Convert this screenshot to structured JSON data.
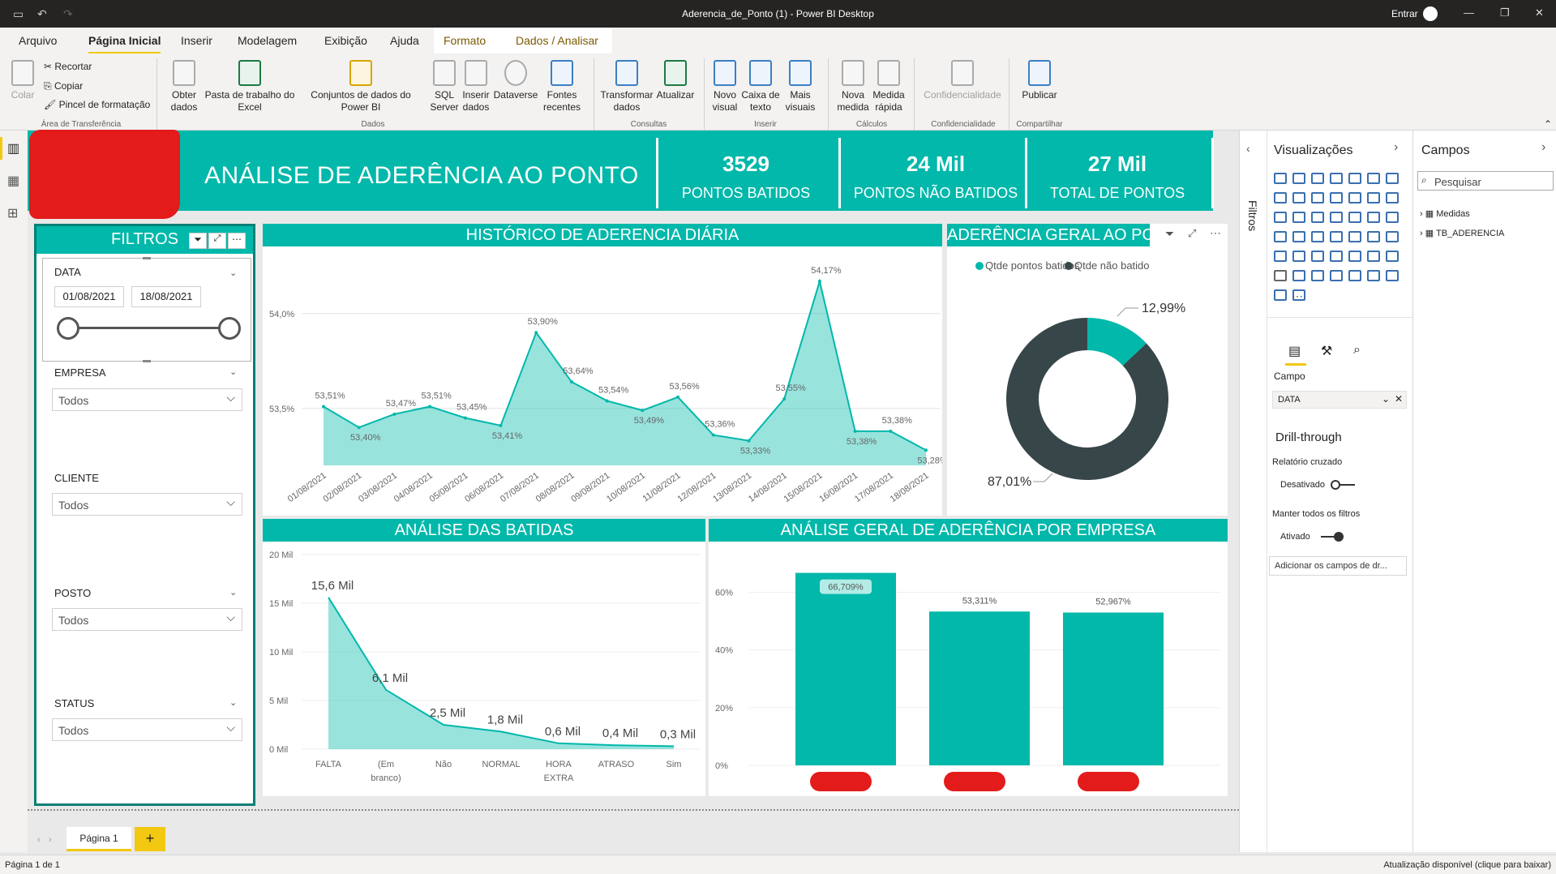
{
  "titlebar": {
    "title": "Aderencia_de_Ponto (1) - Power BI Desktop",
    "signin": "Entrar"
  },
  "menu": {
    "tabs": [
      "Arquivo",
      "Página Inicial",
      "Inserir",
      "Modelagem",
      "Exibição",
      "Ajuda",
      "Formato",
      "Dados / Analisar"
    ],
    "active": "Página Inicial"
  },
  "ribbon": {
    "paste": "Colar",
    "cut": "Recortar",
    "copy": "Copiar",
    "format_painter": "Pincel de formatação",
    "get_data": "Obter dados",
    "excel": "Pasta de trabalho do Excel",
    "datasets": "Conjuntos de dados do Power BI",
    "sql": "SQL Server",
    "enter_data": "Inserir dados",
    "dataverse": "Dataverse",
    "recent": "Fontes recentes",
    "transform": "Transformar dados",
    "refresh": "Atualizar",
    "new_visual": "Novo visual",
    "textbox": "Caixa de texto",
    "more_visuals": "Mais visuais",
    "new_measure": "Nova medida",
    "quick_measure": "Medida rápida",
    "sensitivity": "Confidencialidade",
    "publish": "Publicar",
    "groups": {
      "clipboard": "Área de Transferência",
      "data": "Dados",
      "queries": "Consultas",
      "insert": "Inserir",
      "calc": "Cálculos",
      "sensitivity": "Confidencialidade",
      "share": "Compartilhar"
    }
  },
  "report": {
    "title": "ANÁLISE DE ADERÊNCIA AO PONTO",
    "kpis": [
      {
        "value": "3529",
        "label": "PONTOS BATIDOS"
      },
      {
        "value": "24 Mil",
        "label": "PONTOS NÃO BATIDOS"
      },
      {
        "value": "27 Mil",
        "label": "TOTAL DE PONTOS"
      }
    ],
    "filters": {
      "title": "FILTROS",
      "date_label": "DATA",
      "date_from": "01/08/2021",
      "date_to": "18/08/2021",
      "slicers": [
        {
          "label": "EMPRESA",
          "value": "Todos"
        },
        {
          "label": "CLIENTE",
          "value": "Todos"
        },
        {
          "label": "POSTO",
          "value": "Todos"
        },
        {
          "label": "STATUS",
          "value": "Todos"
        }
      ]
    },
    "hist_title": "HISTÓRICO DE ADERENCIA DIÁRIA",
    "donut_title": "ADERÊNCIA GERAL AO PO",
    "batidas_title": "ANÁLISE DAS BATIDAS",
    "empresa_title": "ANÁLISE GERAL DE ADERÊNCIA POR EMPRESA"
  },
  "chart_data": [
    {
      "type": "area",
      "title": "HISTÓRICO DE ADERENCIA DIÁRIA",
      "x": [
        "01/08/2021",
        "02/08/2021",
        "03/08/2021",
        "04/08/2021",
        "05/08/2021",
        "06/08/2021",
        "07/08/2021",
        "08/08/2021",
        "09/08/2021",
        "10/08/2021",
        "11/08/2021",
        "12/08/2021",
        "13/08/2021",
        "14/08/2021",
        "15/08/2021",
        "16/08/2021",
        "17/08/2021",
        "18/08/2021"
      ],
      "values": [
        53.51,
        53.4,
        53.47,
        53.51,
        53.45,
        53.41,
        53.9,
        53.64,
        53.54,
        53.49,
        53.56,
        53.36,
        53.33,
        53.55,
        54.17,
        53.38,
        53.38,
        53.28
      ],
      "labels": [
        "53,51%",
        "53,40%",
        "53,47%",
        "53,51%",
        "53,45%",
        "53,41%",
        "53,90%",
        "53,64%",
        "53,54%",
        "53,49%",
        "53,56%",
        "53,36%",
        "53,33%",
        "53,55%",
        "54,17%",
        "53,38%",
        "53,38%",
        "53,28%"
      ],
      "y_ticks": [
        "54,0%",
        "53,5%"
      ],
      "y_tick_values": [
        54.0,
        53.5
      ],
      "ylim": [
        53.2,
        54.2
      ],
      "color": "#01b8aa"
    },
    {
      "type": "pie",
      "title": "ADERÊNCIA GERAL AO PO",
      "legend": [
        "Qtde pontos batidos",
        "Qtde não batido"
      ],
      "values": [
        12.99,
        87.01
      ],
      "labels": [
        "12,99%",
        "87,01%"
      ],
      "colors": [
        "#01b8aa",
        "#374649"
      ]
    },
    {
      "type": "area",
      "title": "ANÁLISE DAS BATIDAS",
      "categories": [
        "FALTA",
        "(Em branco)",
        "Não",
        "NORMAL",
        "HORA EXTRA",
        "ATRASO",
        "Sim"
      ],
      "values": [
        15.6,
        6.1,
        2.5,
        1.8,
        0.6,
        0.4,
        0.3
      ],
      "labels": [
        "15,6 Mil",
        "6,1 Mil",
        "2,5 Mil",
        "1,8 Mil",
        "0,6 Mil",
        "0,4 Mil",
        "0,3 Mil"
      ],
      "y_ticks": [
        "20 Mil",
        "15 Mil",
        "10 Mil",
        "5 Mil",
        "0 Mil"
      ],
      "y_tick_values": [
        20,
        15,
        10,
        5,
        0
      ],
      "ylim": [
        0,
        20
      ],
      "color": "#01b8aa"
    },
    {
      "type": "bar",
      "title": "ANÁLISE GERAL DE ADERÊNCIA POR EMPRESA",
      "values": [
        66.709,
        53.311,
        52.967
      ],
      "labels": [
        "66,709%",
        "53,311%",
        "52,967%"
      ],
      "y_ticks": [
        "60%",
        "40%",
        "20%",
        "0%"
      ],
      "y_tick_values": [
        60,
        40,
        20,
        0
      ],
      "ylim": [
        0,
        68
      ],
      "color": "#01b8aa"
    }
  ],
  "viz_pane": {
    "title": "Visualizações",
    "filters_tab": "Filtros",
    "campo_label": "Campo",
    "campo_value": "DATA",
    "drill_title": "Drill-through",
    "cross_report": "Relatório cruzado",
    "off": "Desativado",
    "keep_filters": "Manter todos os filtros",
    "on": "Ativado",
    "add_fields": "Adicionar os campos de dr..."
  },
  "fields_pane": {
    "title": "Campos",
    "search_placeholder": "Pesquisar",
    "tables": [
      "Medidas",
      "TB_ADERENCIA"
    ]
  },
  "pages": {
    "tab": "Página 1",
    "add": "+"
  },
  "status": {
    "left": "Página 1 de 1",
    "right": "Atualização disponível (clique para baixar)"
  }
}
